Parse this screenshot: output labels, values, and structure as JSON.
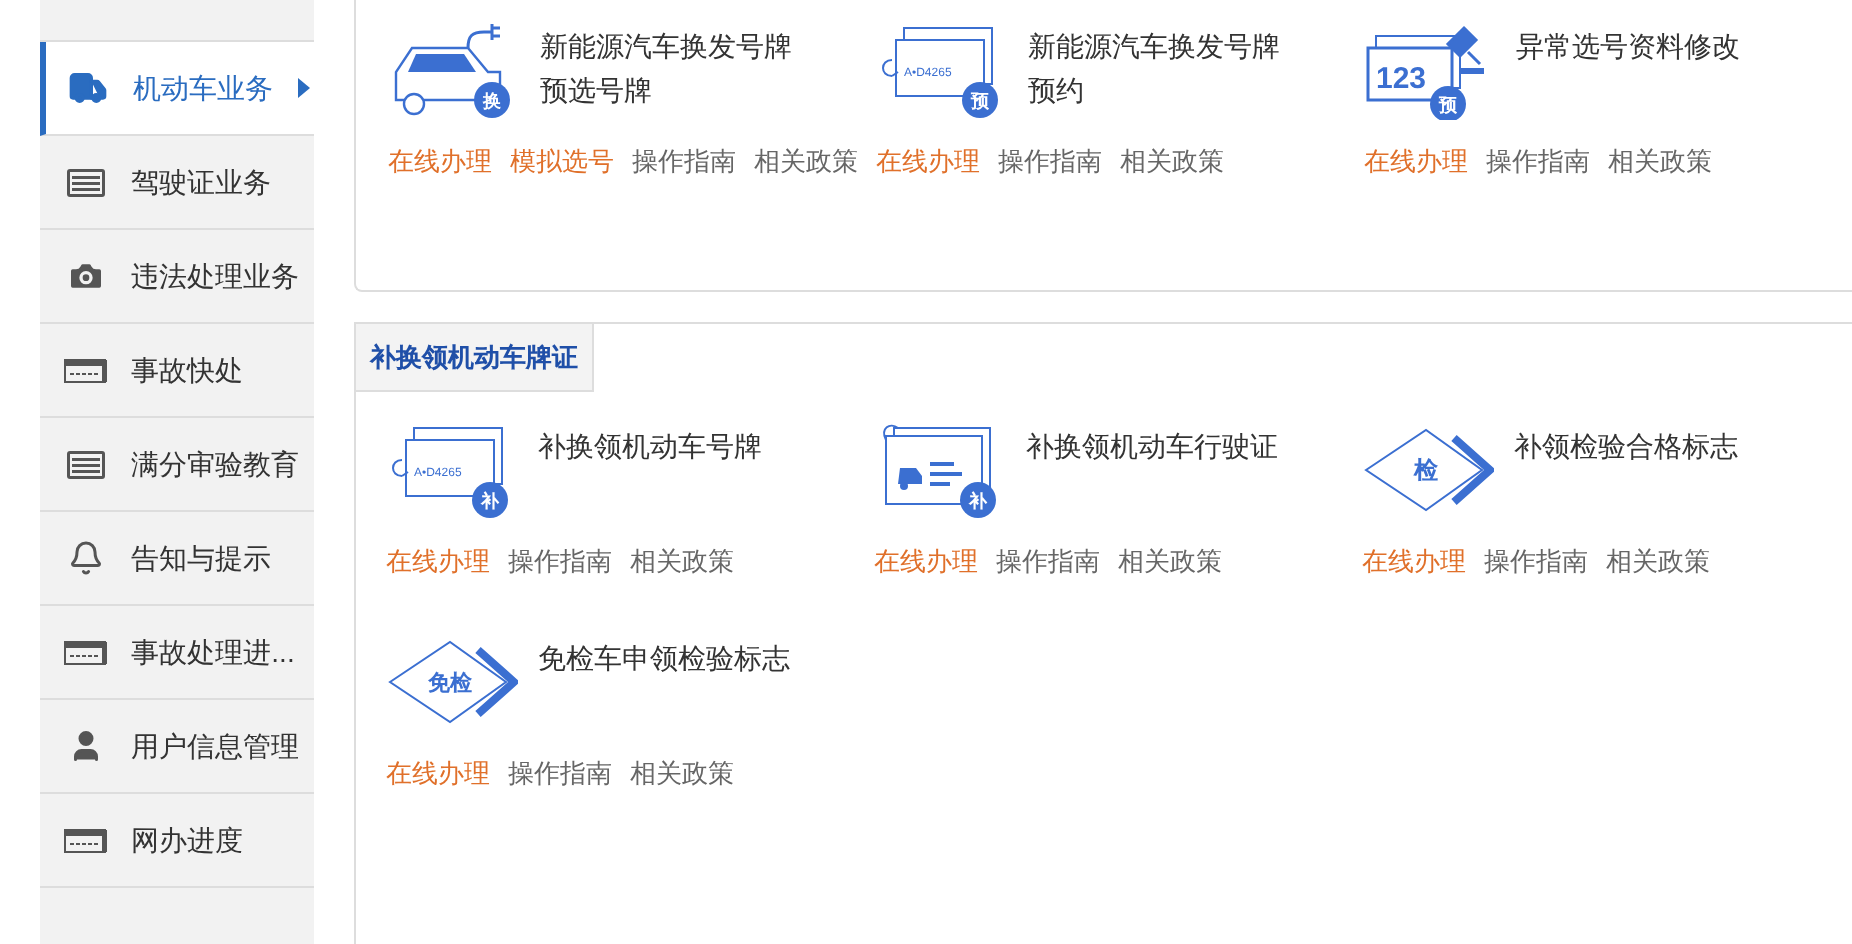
{
  "sidebar": {
    "items": [
      {
        "kind": "cut"
      },
      {
        "kind": "truck",
        "label": "机动车业务",
        "selected": true
      },
      {
        "kind": "card",
        "label": "驾驶证业务",
        "selected": false
      },
      {
        "kind": "camera",
        "label": "违法处理业务",
        "selected": false
      },
      {
        "kind": "ticket",
        "label": "事故快处",
        "selected": false
      },
      {
        "kind": "card",
        "label": "满分审验教育",
        "selected": false
      },
      {
        "kind": "bell",
        "label": "告知与提示",
        "selected": false
      },
      {
        "kind": "ticket",
        "label": "事故处理进...",
        "selected": false
      },
      {
        "kind": "user",
        "label": "用户信息管理",
        "selected": false
      },
      {
        "kind": "ticket",
        "label": "网办进度",
        "selected": false
      },
      {
        "kind": "cut"
      }
    ]
  },
  "sections": [
    {
      "services": [
        {
          "kind": "car",
          "badge": "换",
          "title": "新能源汽车换发号牌预选号牌",
          "links": [
            {
              "label": "在线办理",
              "primary": true
            },
            {
              "label": "模拟选号",
              "primary": true
            },
            {
              "label": "操作指南",
              "primary": false
            },
            {
              "label": "相关政策",
              "primary": false
            }
          ]
        },
        {
          "kind": "plate",
          "badge": "预",
          "plate_text": "A•D4265",
          "title": "新能源汽车换发号牌预约",
          "links": [
            {
              "label": "在线办理",
              "primary": true
            },
            {
              "label": "操作指南",
              "primary": false
            },
            {
              "label": "相关政策",
              "primary": false
            }
          ]
        },
        {
          "kind": "numbers",
          "badge": "预",
          "plate_text": "123",
          "title": "异常选号资料修改",
          "links": [
            {
              "label": "在线办理",
              "primary": true
            },
            {
              "label": "操作指南",
              "primary": false
            },
            {
              "label": "相关政策",
              "primary": false
            }
          ]
        }
      ]
    },
    {
      "tab": "补换领机动车牌证",
      "services": [
        {
          "kind": "plate",
          "badge": "补",
          "plate_text": "A•D4265",
          "title": "补换领机动车号牌",
          "links": [
            {
              "label": "在线办理",
              "primary": true
            },
            {
              "label": "操作指南",
              "primary": false
            },
            {
              "label": "相关政策",
              "primary": false
            }
          ]
        },
        {
          "kind": "license",
          "badge": "补",
          "title": "补换领机动车行驶证",
          "links": [
            {
              "label": "在线办理",
              "primary": true
            },
            {
              "label": "操作指南",
              "primary": false
            },
            {
              "label": "相关政策",
              "primary": false
            }
          ]
        },
        {
          "kind": "diamond",
          "badge": "检",
          "title": "补领检验合格标志",
          "links": [
            {
              "label": "在线办理",
              "primary": true
            },
            {
              "label": "操作指南",
              "primary": false
            },
            {
              "label": "相关政策",
              "primary": false
            }
          ]
        },
        {
          "kind": "diamond",
          "badge": "免检",
          "title": "免检车申领检验标志",
          "links": [
            {
              "label": "在线办理",
              "primary": true
            },
            {
              "label": "操作指南",
              "primary": false
            },
            {
              "label": "相关政策",
              "primary": false
            }
          ]
        }
      ]
    }
  ]
}
